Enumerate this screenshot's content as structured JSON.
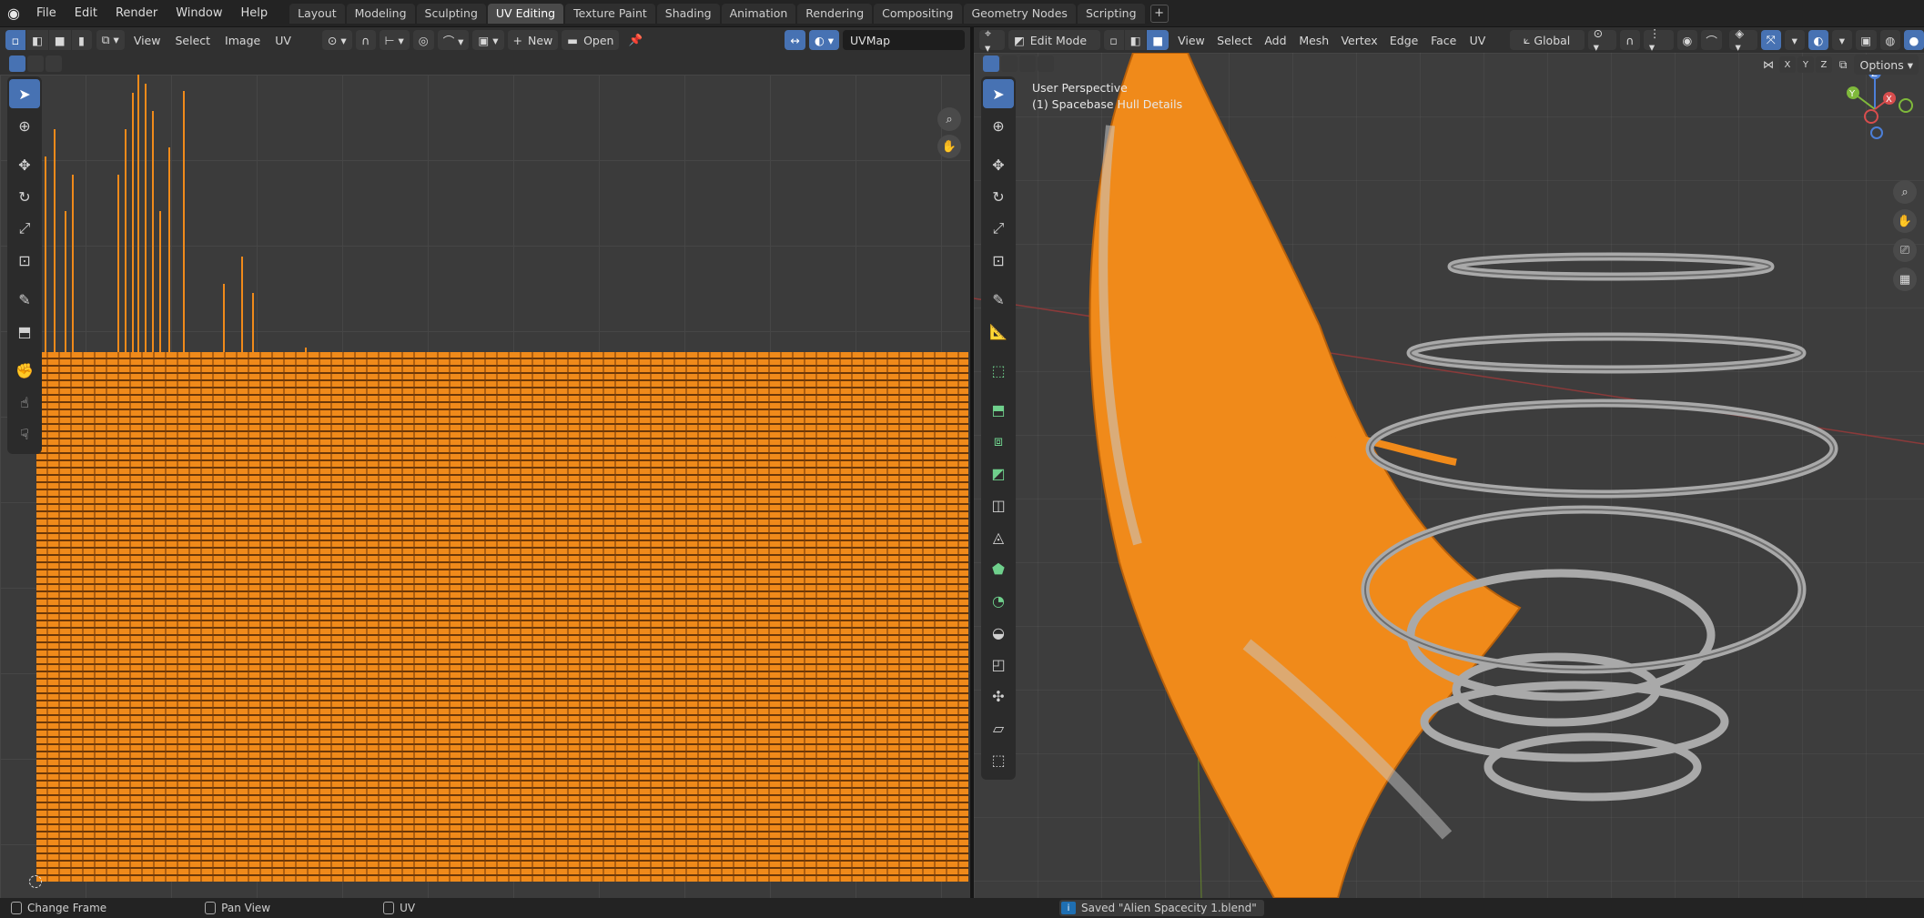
{
  "topbar": {
    "menus": [
      "File",
      "Edit",
      "Render",
      "Window",
      "Help"
    ],
    "tabs": [
      "Layout",
      "Modeling",
      "Sculpting",
      "UV Editing",
      "Texture Paint",
      "Shading",
      "Animation",
      "Rendering",
      "Compositing",
      "Geometry Nodes",
      "Scripting"
    ],
    "active_tab": "UV Editing",
    "add_tab": "+"
  },
  "uv_editor": {
    "menus": [
      "View",
      "Select",
      "Image",
      "UV"
    ],
    "new_label": "New",
    "open_label": "Open",
    "uv_map": "UVMap"
  },
  "viewport": {
    "mode": "Edit Mode",
    "menus": [
      "View",
      "Select",
      "Add",
      "Mesh",
      "Vertex",
      "Edge",
      "Face",
      "UV"
    ],
    "orientation": "Global",
    "axes": [
      "X",
      "Y",
      "Z"
    ],
    "options_label": "Options",
    "perspective": "User Perspective",
    "object": "(1) Spacebase Hull Details"
  },
  "statusbar": {
    "left": "Change Frame",
    "middle": "Pan View",
    "right": "UV",
    "message": "Saved \"Alien Spacecity 1.blend\""
  },
  "colors": {
    "accent": "#4772b3",
    "selection": "#f08a1a"
  }
}
